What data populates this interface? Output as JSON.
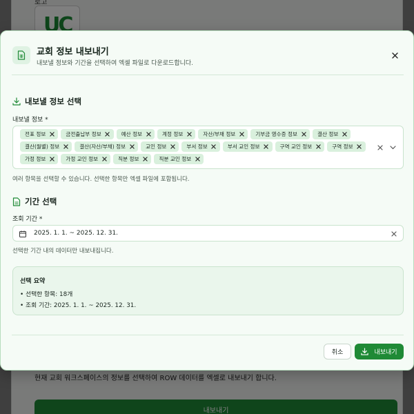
{
  "background": {
    "label": "로고",
    "description": "현재 교회 워크스페이스의 정보를 선택하여 ROW 데이터를 엑셀로 내보내기 합니다.",
    "export_button": "내보내기"
  },
  "dialog": {
    "title": "교회 정보 내보내기",
    "subtitle": "내보낼 정보와 기간을 선택하여 엑셀 파일로 다운로드합니다.",
    "close_icon": "close-icon",
    "info_section": {
      "title": "내보낼 정보 선택",
      "field_label": "내보낼 정보 *",
      "chips": [
        "전표 정보",
        "금전출납부 정보",
        "예산 정보",
        "계정 정보",
        "자산/부채 정보",
        "기부금 영수증 정보",
        "결산 정보",
        "결산(월별) 정보",
        "결산(자산/부채) 정보",
        "교인 정보",
        "부서 정보",
        "부서 교인 정보",
        "구역 교인 정보",
        "구역 정보",
        "가정 정보",
        "가정 교인 정보",
        "직분 정보",
        "직분 교인 정보"
      ],
      "hint": "여러 항목을 선택할 수 있습니다. 선택한 항목만 엑셀 파일에 포함됩니다."
    },
    "period_section": {
      "title": "기간 선택",
      "field_label": "조회 기간 *",
      "value": "2025. 1. 1. ~ 2025. 12. 31.",
      "hint": "선택한 기간 내의 데이터만 내보내집니다."
    },
    "summary": {
      "title": "선택 요약",
      "selected_items": "• 선택한 항목: 18개",
      "period": "• 조회 기간: 2025. 1. 1. ~ 2025. 12. 31."
    },
    "footer": {
      "cancel_label": "취소",
      "export_label": "내보내기"
    }
  },
  "colors": {
    "accent": "#1f8a36",
    "chip_bg": "#d9f0dd",
    "dialog_bg": "#f5fbf6",
    "border": "#c9e3cd"
  }
}
